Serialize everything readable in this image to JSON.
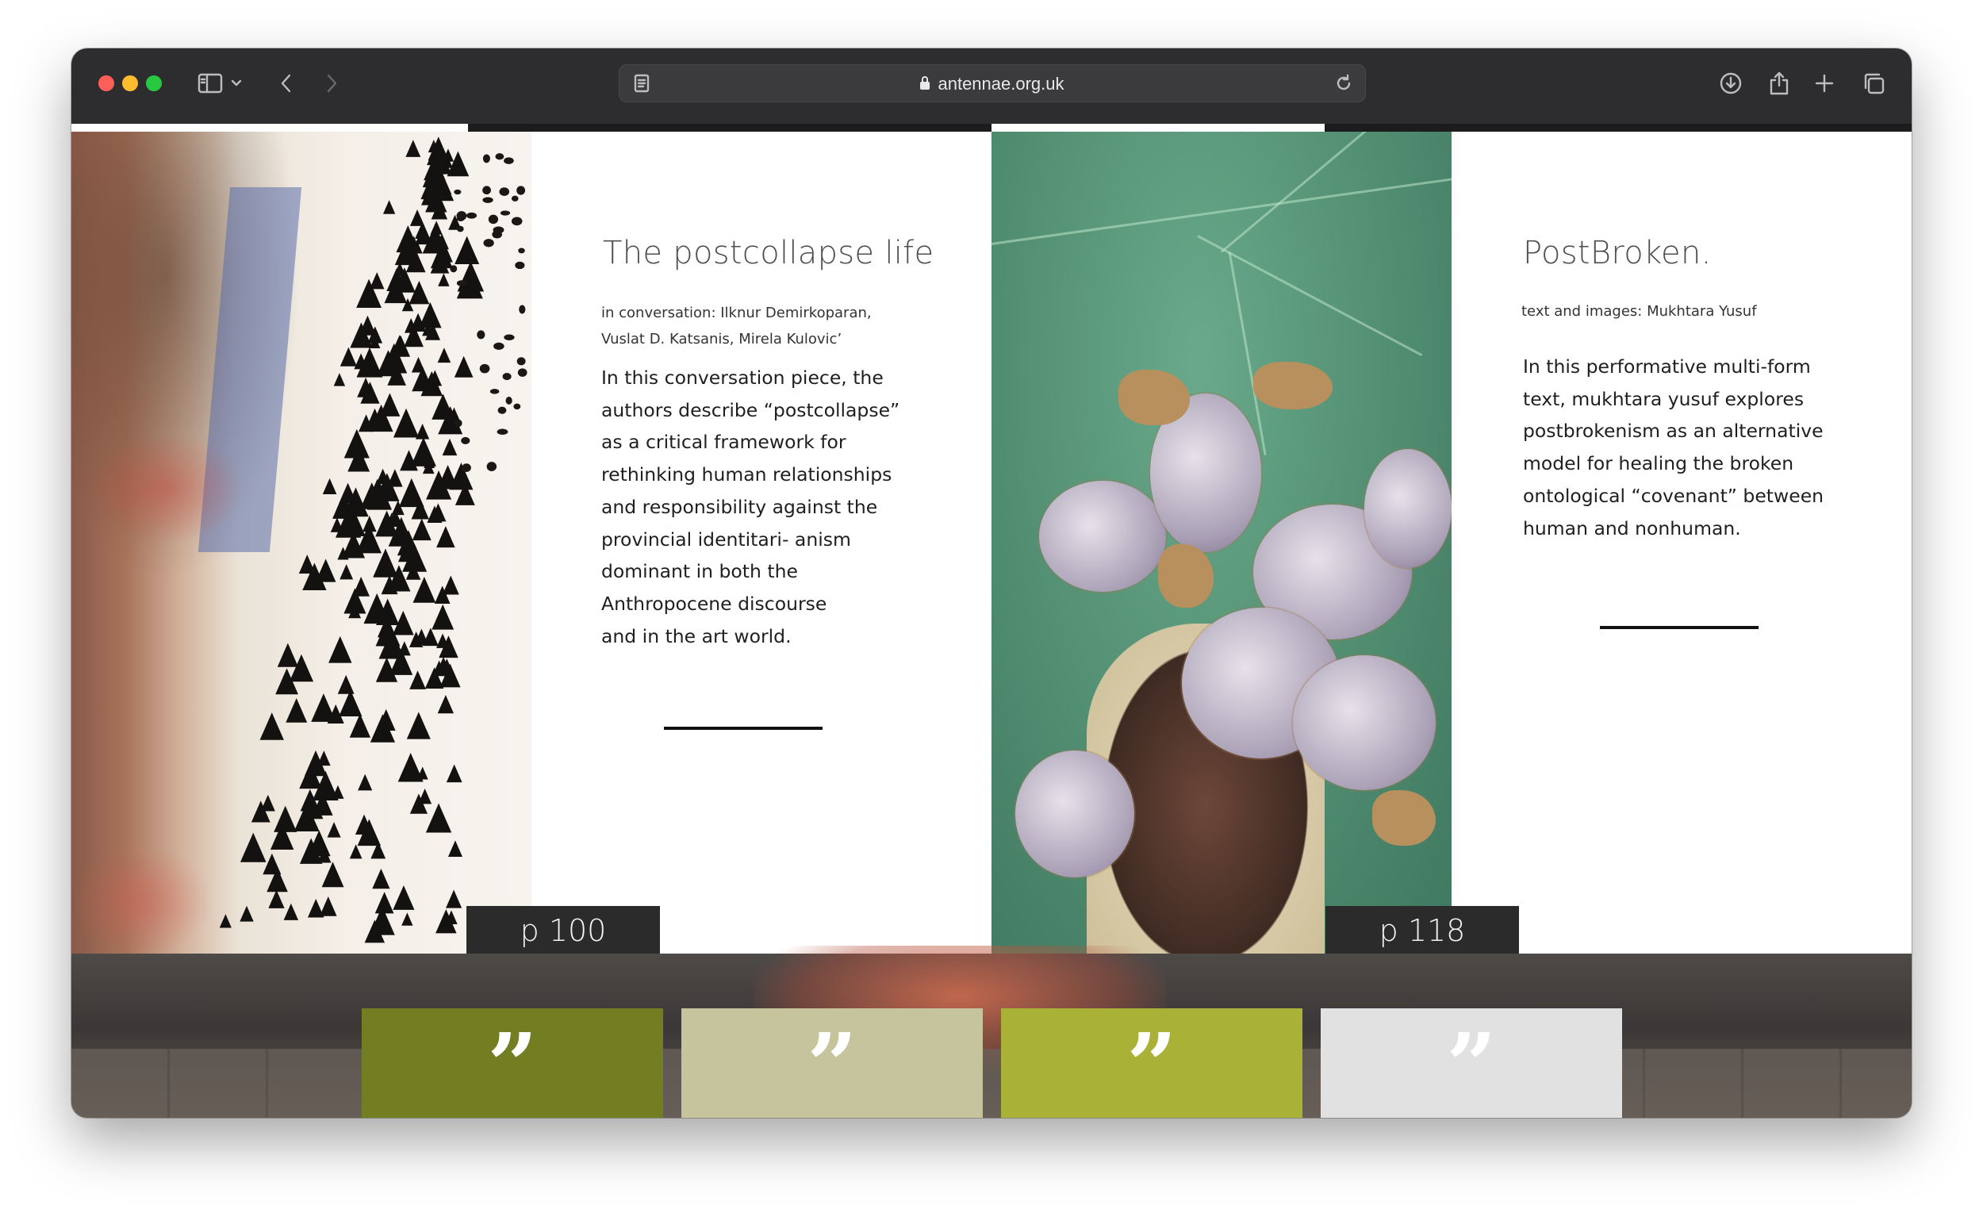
{
  "browser": {
    "url": "antennae.org.uk",
    "icons": {
      "sidebar": "sidebar-icon",
      "chevron": "chevron-down-icon",
      "back": "back-arrow-icon",
      "forward": "forward-arrow-icon",
      "reader": "reader-mode-icon",
      "lock": "lock-icon",
      "reload": "reload-icon",
      "download": "download-icon",
      "share": "share-icon",
      "new_tab": "plus-icon",
      "tabs": "tab-overview-icon"
    }
  },
  "articles": [
    {
      "title": "The postcollapse life",
      "byline_lines": [
        "in conversation: Ilknur Demirkoparan,",
        "Vuslat D. Katsanis, Mirela Kulovic’"
      ],
      "body_lines": [
        "In this conversation piece, the",
        "authors describe “postcollapse”",
        "as a critical framework for",
        "rethinking human relationships",
        "and responsibility against the",
        "provincial identitari- anism",
        "dominant in both the",
        "Anthropocene discourse",
        "and in the art world."
      ],
      "page": "p 100"
    },
    {
      "title": "PostBroken.",
      "byline_lines": [
        "text and images: Mukhtara Yusuf"
      ],
      "body_lines": [
        "In this performative multi-form",
        "text, mukhtara yusuf explores",
        "postbrokenism as an alternative",
        "model for healing the broken",
        "ontological “covenant” between",
        "human and nonhuman."
      ],
      "page": "p 118"
    }
  ],
  "quote_cards": [
    {
      "glyph": "”",
      "color": "#737d22"
    },
    {
      "glyph": "”",
      "color": "#c5c49d"
    },
    {
      "glyph": "”",
      "color": "#a9b236"
    },
    {
      "glyph": "”",
      "color": "#e1e1e1"
    }
  ]
}
